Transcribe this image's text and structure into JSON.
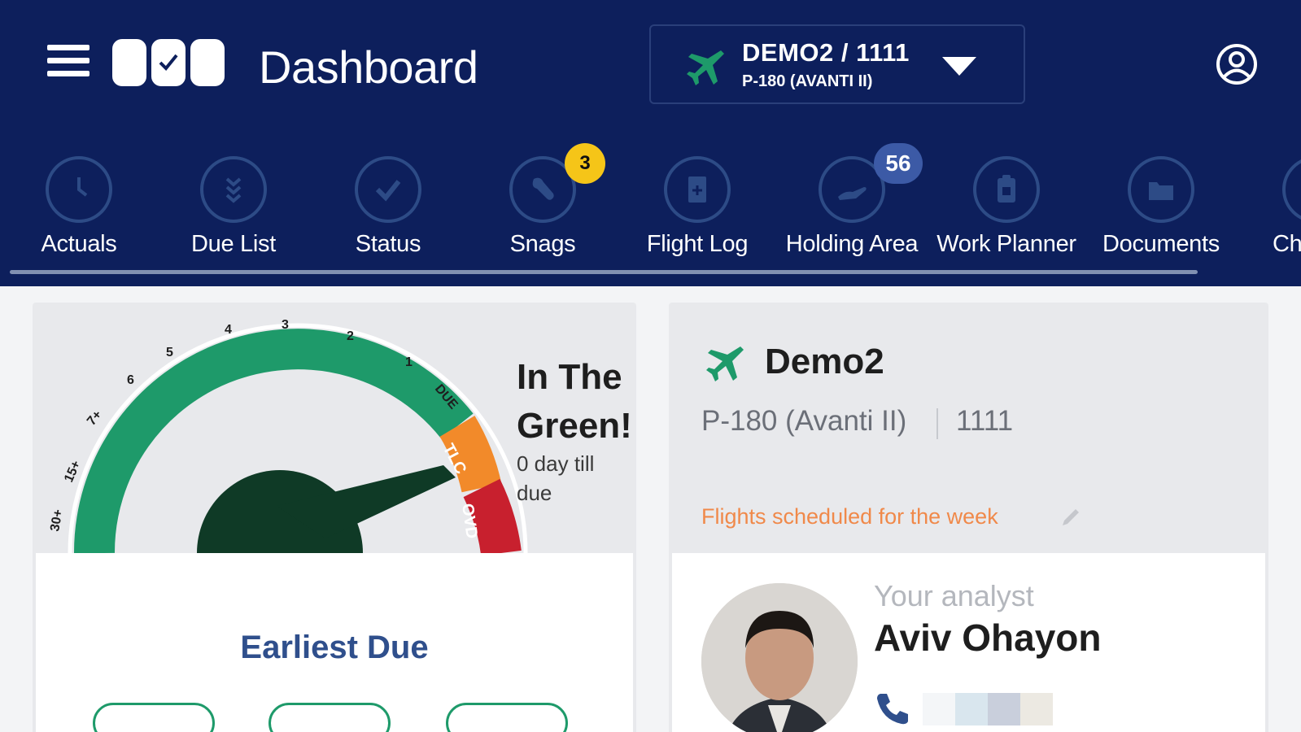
{
  "header": {
    "title": "Dashboard",
    "aircraft_selector": {
      "main": "DEMO2 / 1111",
      "sub": "P-180 (AVANTI II)"
    }
  },
  "nav": {
    "items": [
      {
        "label": "Actuals",
        "icon": "clock-icon"
      },
      {
        "label": "Due List",
        "icon": "chevrons-down-icon"
      },
      {
        "label": "Status",
        "icon": "check-icon"
      },
      {
        "label": "Snags",
        "icon": "wrench-icon",
        "badge": "3"
      },
      {
        "label": "Flight Log",
        "icon": "document-icon"
      },
      {
        "label": "Holding Area",
        "icon": "hand-icon",
        "badge": "56"
      },
      {
        "label": "Work Planner",
        "icon": "clipboard-icon"
      },
      {
        "label": "Documents",
        "icon": "folder-icon"
      },
      {
        "label": "Ch",
        "icon": "partial-icon"
      }
    ]
  },
  "gauge_card": {
    "title": "In The Green!",
    "subtitle": "0 day till due",
    "tick_labels": [
      "30+",
      "15+",
      "7+",
      "6",
      "5",
      "4",
      "3",
      "2",
      "1",
      "DUE"
    ],
    "zone_labels": [
      "TLC",
      "OVD"
    ],
    "earliest_due": "Earliest Due",
    "colors": {
      "green": "#1e9a6a",
      "orange": "#f28a2a",
      "red": "#c8202e",
      "needle": "#0f3a26"
    }
  },
  "aircraft_card": {
    "name": "Demo2",
    "model": "P-180 (Avanti II)",
    "serial": "1111",
    "flights_link": "Flights scheduled for the week",
    "analyst_label": "Your analyst",
    "analyst_name": "Aviv Ohayon"
  }
}
